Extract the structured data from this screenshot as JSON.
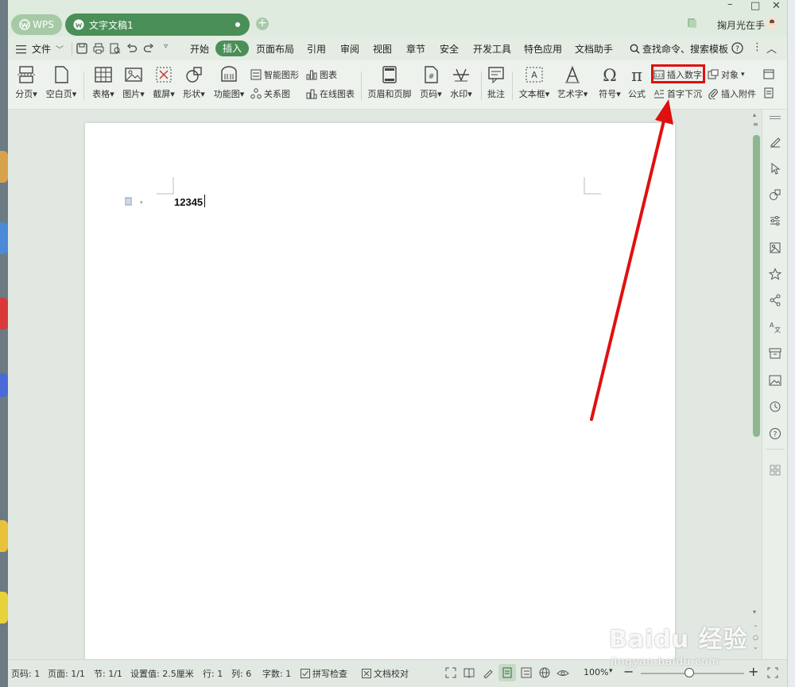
{
  "titlebar": {
    "app_tab": "WPS",
    "doc_tab": "文字文稿1",
    "new_tab_symbol": "+",
    "user_name": "掬月光在手"
  },
  "menubar": {
    "file": "文件",
    "items": [
      "开始",
      "插入",
      "页面布局",
      "引用",
      "审阅",
      "视图",
      "章节",
      "安全",
      "开发工具",
      "特色应用",
      "文档助手"
    ],
    "active": "插入",
    "search": "查找命令、搜索模板"
  },
  "ribbon": {
    "page_break": "分页",
    "blank_page": "空白页",
    "table": "表格",
    "picture": "图片",
    "screenshot": "截屏",
    "shape": "形状",
    "function_chart": "功能图",
    "smart_graphic": "智能图形",
    "chart": "图表",
    "relation_chart": "关系图",
    "online_chart": "在线图表",
    "header_footer": "页眉和页脚",
    "page_number": "页码",
    "watermark": "水印",
    "comment": "批注",
    "textbox": "文本框",
    "wordart": "艺术字",
    "symbol": "符号",
    "formula": "公式",
    "insert_number": "插入数字",
    "object": "对象",
    "drop_cap": "首字下沉",
    "insert_attachment": "插入附件"
  },
  "document": {
    "text": "12345"
  },
  "statusbar": {
    "page": "页码: 1",
    "pages": "页面: 1/1",
    "section": "节: 1/1",
    "setting": "设置值: 2.5厘米",
    "row": "行: 1",
    "col": "列: 6",
    "word_count": "字数: 1",
    "spell_check": "拼写检查",
    "doc_proof": "文档校对",
    "zoom": "100%"
  },
  "watermark": {
    "logo": "Baidu 经验",
    "url": "jingyan.baidu.com"
  },
  "colors": {
    "accent": "#4a8f57",
    "highlight": "#e01010",
    "arrow": "#e01010"
  }
}
